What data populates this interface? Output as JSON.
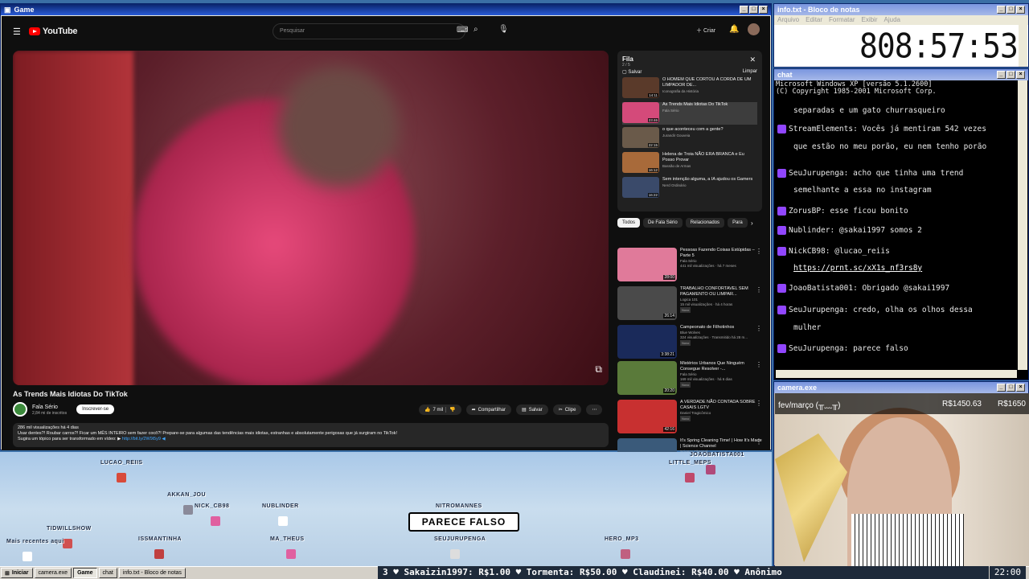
{
  "game_window": {
    "title": "Game"
  },
  "youtube": {
    "logo": "YouTube",
    "search_placeholder": "Pesquisar",
    "create": "Criar",
    "video_title": "As Trends Mais Idiotas Do TikTok",
    "channel": "Fala Sério",
    "subs": "2,84 mi de inscritos",
    "subscribe": "Inscrever-se",
    "likes": "7 mil",
    "share": "Compartilhar",
    "save": "Salvar",
    "clip": "Clipe",
    "desc_line1": "286 mil visualizações  há 4 dias",
    "desc_line2": "Usar dentes?! Roubar carros?! Ficar um MÊS INTEIRO sem fazer cocô?! Prepare-se para algumas das tendências mais idiotas, estranhas e absolutamente perigosas que já surgiram no TikTok!",
    "desc_line3": "Sugira um tópico para ser transformado em vídeo: ▶",
    "desc_link": "http://bit.ly/2W9i5y9 ◀",
    "queue": {
      "title": "Fila",
      "count": "2 / 5",
      "save": "Salvar",
      "clear": "Limpar",
      "items": [
        {
          "title": "O HOMEM QUE CORTOU A CORDA DE UM LIMPADOR DE...",
          "channel": "Iconografia da História",
          "dur": "14:11",
          "color": "#5a3a2a"
        },
        {
          "title": "As Trends Mais Idiotas Do TikTok",
          "channel": "Fala Sério",
          "dur": "23:46",
          "color": "#d44a7a"
        },
        {
          "title": "o que aconteceu com a gente?",
          "channel": "Jurandir Gouveia",
          "dur": "22:15",
          "color": "#6a5a4a"
        },
        {
          "title": "Helena de Troia NÃO ERA BRANCA e Eu Posso Provar",
          "channel": "Bassão de Armas",
          "dur": "16:12",
          "color": "#a86a3a"
        },
        {
          "title": "Sem intenção alguma, a IA ajudou os Gamers",
          "channel": "Nerd Ordinário",
          "dur": "16:22",
          "color": "#3a4a6a"
        }
      ]
    },
    "chips": [
      "Todos",
      "De Fala Sério",
      "Relacionados",
      "Para"
    ],
    "recs": [
      {
        "title": "Pessoas Fazendo Coisas Estúpidas – Parte 5",
        "channel": "Fala Sério",
        "meta": "441 mil visualizações · há 7 meses",
        "dur": "28:00",
        "badge": "",
        "color": "#e07a9a"
      },
      {
        "title": "TRABALHO CONFORTAVEL SEM PAGAMENTO OU LIMPAR...",
        "channel": "Logica 101",
        "meta": "15 mil visualizações · há 4 horas",
        "dur": "26:14",
        "badge": "Novo",
        "color": "#4a4a4a"
      },
      {
        "title": "Campeonato de Filhotinhos",
        "channel": "Blue Wolves",
        "meta": "324 visualizações · Transmitido há 28 m...",
        "dur": "3:38:21",
        "badge": "Novo",
        "color": "#1a2a5a"
      },
      {
        "title": "Mistérios Urbanos Que Ninguém Consegue Resolver -...",
        "channel": "Fala Sério",
        "meta": "169 mil visualizações · há 6 dias",
        "dur": "20:20",
        "badge": "Novo",
        "color": "#5a7a3a"
      },
      {
        "title": "A VERDADE NÃO CONTADA SOBRE CASAIS LGTV",
        "channel": "Daniel Tragicômico",
        "meta": "",
        "dur": "42:16",
        "badge": "Novo",
        "color": "#c83030"
      },
      {
        "title": "It's Spring Cleaning Time! | How It's Made | Science Channel",
        "channel": "Science Channel",
        "meta": "",
        "dur": "",
        "badge": "",
        "color": "#3a5a7a"
      }
    ]
  },
  "players": [
    {
      "name": "LUCAO_REIIS"
    },
    {
      "name": "AKKAN_JOU"
    },
    {
      "name": "NICK_CB98"
    },
    {
      "name": "NUBLINDER"
    },
    {
      "name": "TIDWILLSHOW"
    },
    {
      "name": "ISSMANTINHA"
    },
    {
      "name": "MA_THEUS"
    },
    {
      "name": "NITROMANNES"
    },
    {
      "name": "SEUJURUPENGA"
    },
    {
      "name": "HERO_MP3"
    },
    {
      "name": "LITTLE_MEPS"
    },
    {
      "name": "JOAOBATISTA001"
    },
    {
      "name": "Mais recentes aqui"
    }
  ],
  "speech_bubble": "PARECE FALSO",
  "notepad": {
    "title": "info.txt - Bloco de notas",
    "menu": [
      "Arquivo",
      "Editar",
      "Formatar",
      "Exibir",
      "Ajuda"
    ],
    "value": "808:57:53"
  },
  "chat": {
    "title": "chat",
    "header1": "Microsoft Windows XP [versão 5.1.2600]",
    "header2": "(C) Copyright 1985-2001 Microsoft Corp.",
    "lines": [
      {
        "text": "separadas e um gato churrasqueiro",
        "icon": false
      },
      {
        "text": "StreamElements: Vocês já mentiram 542 vezes",
        "icon": true
      },
      {
        "text": "que estão no meu porão, eu nem tenho porão",
        "icon": false
      },
      {
        "text": "SeuJurupenga: acho que tinha uma trend",
        "icon": true
      },
      {
        "text": "semelhante a essa no instagram",
        "icon": false
      },
      {
        "text": "ZorusBP: esse ficou bonito",
        "icon": true
      },
      {
        "text": "Nublinder: @sakai1997 somos 2",
        "icon": true
      },
      {
        "text": "NickCB98: @lucao_reiis",
        "icon": true
      },
      {
        "text": "https://prnt.sc/xX1s_nf3rs8y",
        "icon": false
      },
      {
        "text": "JoaoBatista001: Obrigado @sakai1997",
        "icon": true
      },
      {
        "text": "SeuJurupenga: credo, olha os olhos dessa",
        "icon": true
      },
      {
        "text": "mulher",
        "icon": false
      },
      {
        "text": "SeuJurupenga: parece falso",
        "icon": true
      }
    ]
  },
  "camera": {
    "title": "camera.exe",
    "goal_label": "fev/março (╥﹏╥)",
    "current": "R$1450.63",
    "goal": "R$1650"
  },
  "taskbar": {
    "start": "Iniciar",
    "buttons": [
      "camera.exe",
      "Game",
      "chat",
      "info.txt - Bloco de notas"
    ],
    "ticker": "3  ♥  Sakaizin1997: R$1.00  ♥  Tormenta: R$50.00  ♥  Claudinei: R$40.00  ♥  Anônimo",
    "clock": "22:00"
  }
}
